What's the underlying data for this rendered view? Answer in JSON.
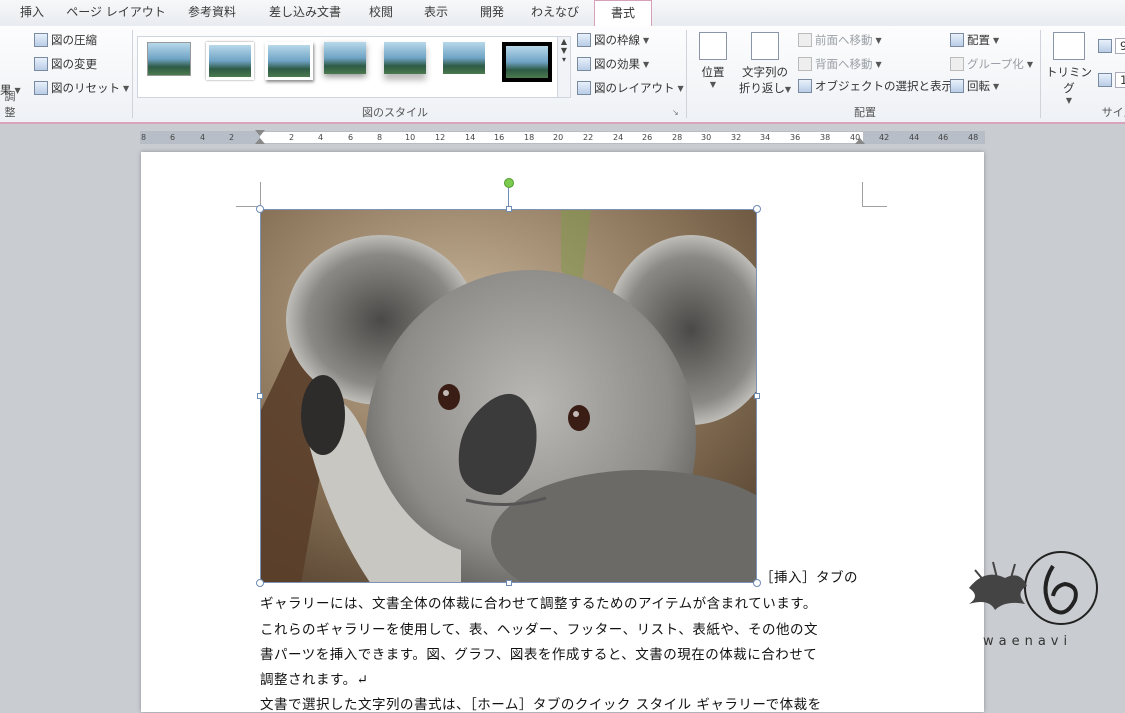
{
  "tabs": [
    {
      "label": "挿入",
      "active": false
    },
    {
      "label": "ページ レイアウト",
      "active": false
    },
    {
      "label": "参考資料",
      "active": false
    },
    {
      "label": "差し込み文書",
      "active": false
    },
    {
      "label": "校閲",
      "active": false
    },
    {
      "label": "表示",
      "active": false
    },
    {
      "label": "開発",
      "active": false
    },
    {
      "label": "わえなび",
      "active": false
    },
    {
      "label": "書式",
      "active": true
    }
  ],
  "ribbon": {
    "adjust": {
      "label": "調整",
      "effect_partial": "果",
      "compress": "図の圧縮",
      "change": "図の変更",
      "reset": "図のリセット"
    },
    "styles": {
      "label": "図のスタイル",
      "border": "図の枠線",
      "effects": "図の効果",
      "layout": "図のレイアウト"
    },
    "arrange": {
      "label": "配置",
      "position": "位置",
      "wrap_line1": "文字列の",
      "wrap_line2": "折り返し",
      "bring_forward": "前面へ移動",
      "send_backward": "背面へ移動",
      "selection_pane": "オブジェクトの選択と表示",
      "align": "配置",
      "group": "グループ化",
      "rotate": "回転"
    },
    "size": {
      "label": "サイズ",
      "crop": "トリミング",
      "height_partial": "9",
      "width_partial": "1"
    }
  },
  "ruler": {
    "ticks": [
      "8",
      "6",
      "4",
      "2",
      "2",
      "4",
      "6",
      "8",
      "10",
      "12",
      "14",
      "16",
      "18",
      "20",
      "22",
      "24",
      "26",
      "28",
      "30",
      "32",
      "34",
      "36",
      "38",
      "40",
      "42",
      "44",
      "46",
      "48"
    ]
  },
  "document": {
    "lines": [
      "［挿入］タブの",
      "ギャラリーには、文書全体の体裁に合わせて調整するためのアイテムが含まれています。",
      "これらのギャラリーを使用して、表、ヘッダー、フッター、リスト、表紙や、その他の文",
      "書パーツを挿入できます。図、グラフ、図表を作成すると、文書の現在の体裁に合わせて",
      "調整されます。↵",
      "文書で選択した文字列の書式は、［ホーム］タブのクイック スタイル ギャラリーで体裁を"
    ]
  },
  "watermark": {
    "text": "waenavi"
  }
}
